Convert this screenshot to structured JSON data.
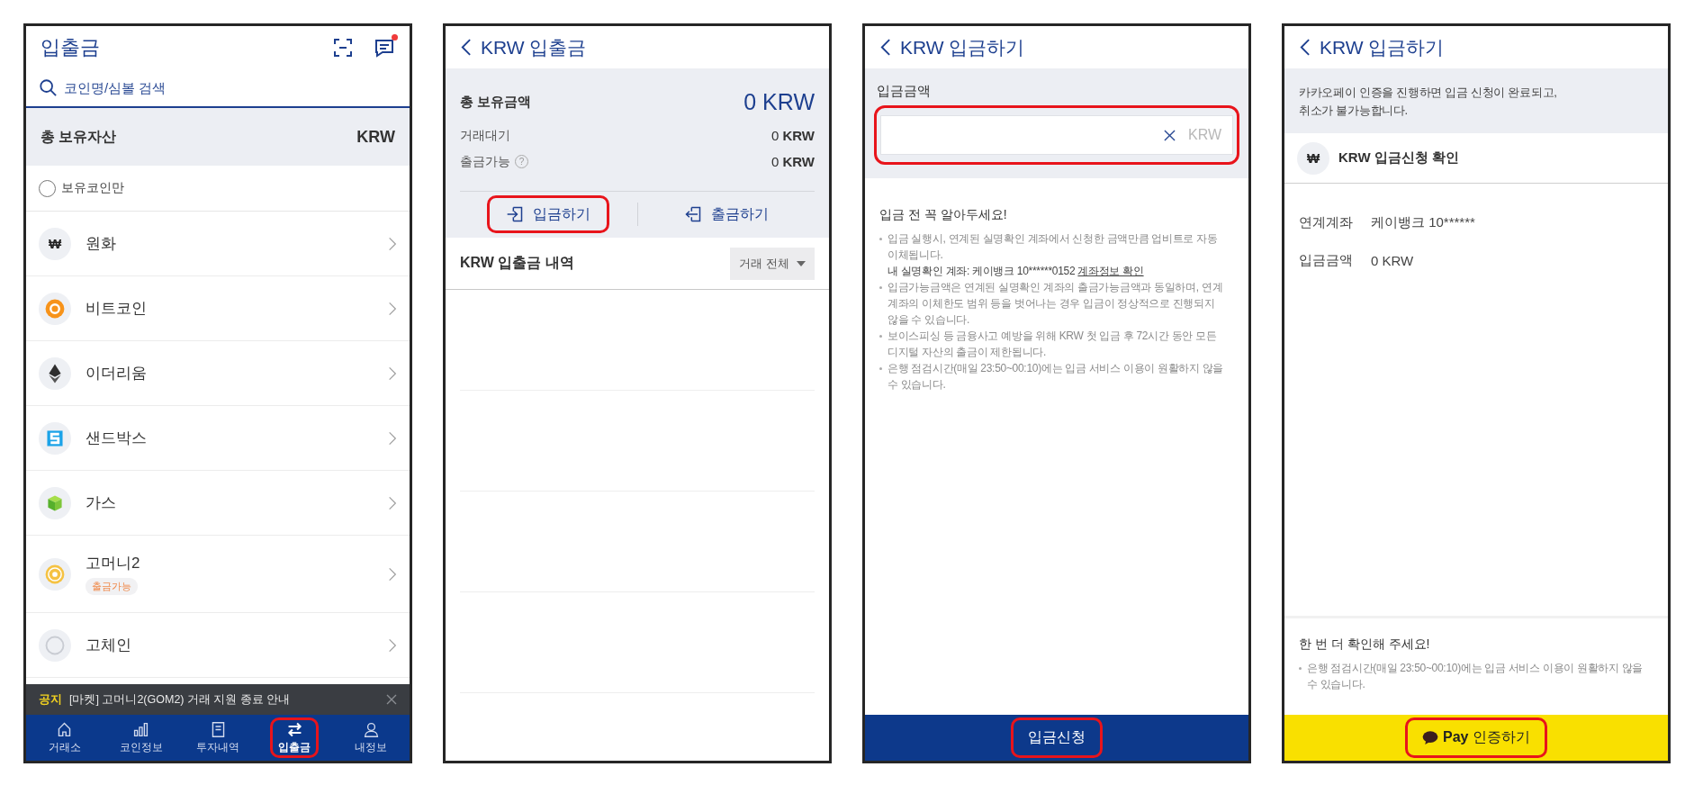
{
  "asset_screen": {
    "header": {
      "title": "입출금",
      "has_notification": true
    },
    "search": {
      "placeholder": "코인명/심볼 검색"
    },
    "total_assets": {
      "label": "총 보유자산",
      "value": "KRW"
    },
    "filter": {
      "label": "보유코인만",
      "checked": false
    },
    "coins": [
      {
        "name": "원화",
        "symbol": "₩"
      },
      {
        "name": "비트코인"
      },
      {
        "name": "이더리움"
      },
      {
        "name": "샌드박스"
      },
      {
        "name": "가스"
      },
      {
        "name": "고머니2",
        "badge": "출금가능"
      },
      {
        "name": "고체인"
      }
    ],
    "notice": {
      "label": "공지",
      "text": "[마켓] 고머니2(GOM2) 거래 지원 종료 안내"
    },
    "nav": [
      {
        "label": "거래소",
        "selected": false,
        "highlighted": false
      },
      {
        "label": "코인정보",
        "selected": false,
        "highlighted": false
      },
      {
        "label": "투자내역",
        "selected": false,
        "highlighted": false
      },
      {
        "label": "입출금",
        "selected": true,
        "highlighted": true
      },
      {
        "label": "내정보",
        "selected": false,
        "highlighted": false
      }
    ]
  },
  "krw_screen": {
    "header": {
      "title": "KRW 입출금"
    },
    "balance": {
      "label": "총 보유금액",
      "value": "0 KRW",
      "rows": [
        {
          "label": "거래대기",
          "value": "0 **KRW**"
        },
        {
          "label": "출금가능",
          "hint": "?",
          "value": "0 **KRW**"
        }
      ]
    },
    "actions": [
      {
        "kind": "deposit",
        "label": "입금하기",
        "highlighted": true
      },
      {
        "kind": "withdraw",
        "label": "출금하기",
        "highlighted": false
      }
    ],
    "history": {
      "title": "KRW 입출금 내역",
      "filter": "거래 전체"
    }
  },
  "deposit_screen": {
    "header": {
      "title": "KRW 입금하기"
    },
    "amount": {
      "label": "입금금액",
      "unit": "KRW",
      "highlighted": true
    },
    "notes": {
      "title": "입금 전 꼭 알아두세요!",
      "items": [
        {
          "text": "입금 실행시, 연계된 실명확인 계좌에서 신청한 금액만큼 업비트로 자동 이체됩니다.",
          "account": "내 실명확인 계좌: 케이뱅크 10******0152",
          "link": "계좌정보 확인"
        },
        {
          "text": "입금가능금액은 연계된 실명확인 계좌의 출금가능금액과 동일하며, 연계 계좌의 이체한도 범위 등을 벗어나는 경우 입금이 정상적으로 진행되지 않을 수 있습니다."
        },
        {
          "text": "보이스피싱 등 금융사고 예방을 위해 KRW 첫 입금 후 72시간 동안 모든 디지털 자산의 출금이 제한됩니다."
        },
        {
          "text": "은행 점검시간(매일 23:50~00:10)에는 입금 서비스 이용이 원활하지 않을 수 있습니다."
        }
      ]
    },
    "submit": {
      "label": "입금신청",
      "highlighted": true
    }
  },
  "confirm_screen": {
    "header": {
      "title": "KRW 입금하기"
    },
    "info": "카카오페이 인증을 진행하면 입금 신청이 완료되고,\n취소가 불가능합니다.",
    "heading": {
      "symbol": "₩",
      "text": "KRW 입금신청 확인"
    },
    "details": [
      {
        "label": "연계계좌",
        "value": "케이뱅크 10******"
      },
      {
        "label": "입금금액",
        "value": "0 KRW"
      }
    ],
    "notes": {
      "title": "한 번 더 확인해 주세요!",
      "items": [
        "은행 점검시간(매일 23:50~00:10)에는 입금 서비스 이용이 원활하지 않을 수 있습니다."
      ]
    },
    "pay_button": {
      "label": "**Pay** 인증하기",
      "highlighted": true
    }
  }
}
